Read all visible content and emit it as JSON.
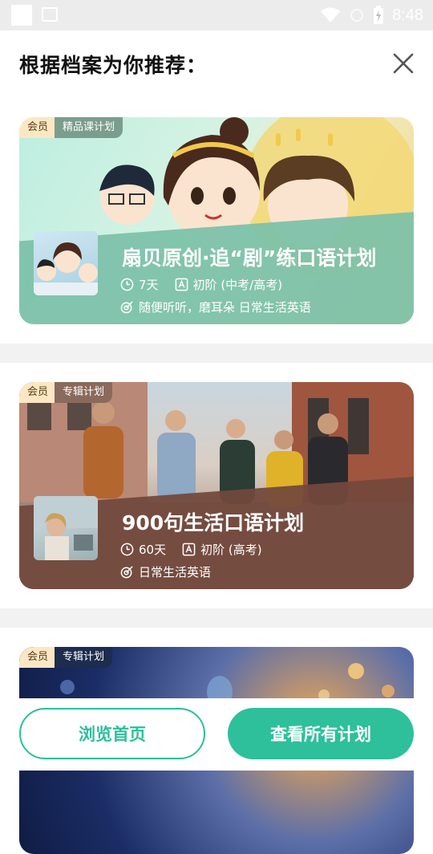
{
  "status_bar": {
    "time": "8:48"
  },
  "header": {
    "title": "根据档案为你推荐："
  },
  "cards": [
    {
      "vip_label": "会员",
      "type_label": "精品课计划",
      "title": "扇贝原创·追“剧”练口语计划",
      "duration": "7天",
      "level": "初阶 (中考/高考)",
      "tags": "随便听听，磨耳朵 日常生活英语",
      "accent": "#7cc1a9"
    },
    {
      "vip_label": "会员",
      "type_label": "专辑计划",
      "title": "900句生活口语计划",
      "duration": "60天",
      "level": "初阶 (高考)",
      "tags": "日常生活英语",
      "accent": "#73483d"
    },
    {
      "vip_label": "会员",
      "type_label": "专辑计划"
    }
  ],
  "buttons": {
    "browse_home": "浏览首页",
    "view_all": "查看所有计划"
  },
  "colors": {
    "primary": "#2dc09a"
  }
}
